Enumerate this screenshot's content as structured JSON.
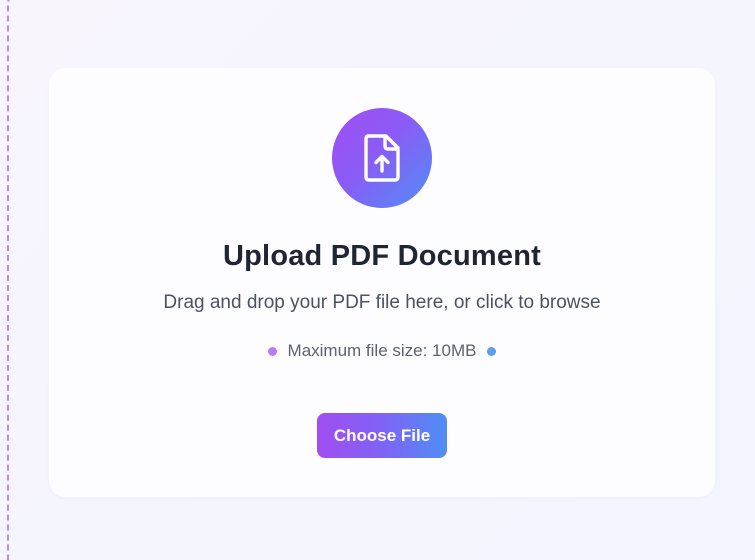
{
  "upload": {
    "icon": "file-upload-icon",
    "title": "Upload PDF Document",
    "subtitle": "Drag and drop your PDF file here, or click to browse",
    "limit_text": "Maximum file size: 10MB",
    "button_label": "Choose File"
  },
  "colors": {
    "accent_purple": "#a24df2",
    "accent_blue": "#4f8ef5",
    "border_dashed": "#b98ae8",
    "title_text": "#1f2533"
  }
}
